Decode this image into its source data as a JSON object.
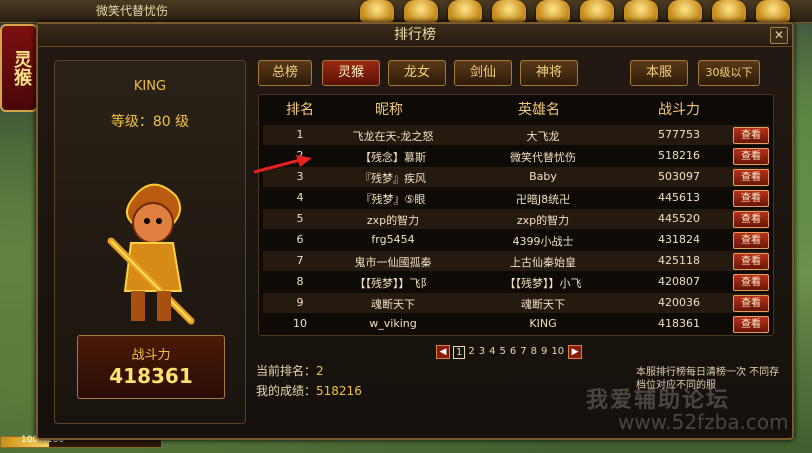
{
  "topbar": {
    "title": "微笑代替忧伤"
  },
  "left_tab": {
    "label": "灵猴"
  },
  "hp": {
    "text": "1007/100",
    "fill_fraction": 0.3
  },
  "window": {
    "title": "排行榜",
    "close": "✕"
  },
  "hero": {
    "name": "KING",
    "level": "等级：80 级",
    "power_label": "战斗力",
    "power_value": "418361"
  },
  "tabs": [
    "总榜",
    "灵猴",
    "龙女",
    "剑仙",
    "神将",
    "本服",
    "30级以下"
  ],
  "active_tab": 1,
  "table": {
    "headers": [
      "排名",
      "昵称",
      "英雄名",
      "战斗力"
    ],
    "view_label": "查看",
    "rows": [
      {
        "rank": "1",
        "nick": "飞龙在天-龙之怒",
        "hero": "大飞龙",
        "power": "577753"
      },
      {
        "rank": "2",
        "nick": "【残念】慕斯",
        "hero": "微笑代替忧伤",
        "power": "518216"
      },
      {
        "rank": "3",
        "nick": "『残梦』疾风",
        "hero": "Baby",
        "power": "503097"
      },
      {
        "rank": "4",
        "nick": "『残梦』⑤眼",
        "hero": "卍暗J8统卍",
        "power": "445613"
      },
      {
        "rank": "5",
        "nick": "zxp的智力",
        "hero": "zxp的智力",
        "power": "445520"
      },
      {
        "rank": "6",
        "nick": "frg5454",
        "hero": "4399小战士",
        "power": "431824"
      },
      {
        "rank": "7",
        "nick": "鬼市一仙國孤秦",
        "hero": "上古仙秦始皇",
        "power": "425118"
      },
      {
        "rank": "8",
        "nick": "【【残梦】】飞阝",
        "hero": "【【残梦】】小飞",
        "power": "420807"
      },
      {
        "rank": "9",
        "nick": "魂断天下",
        "hero": "魂断天下",
        "power": "420036"
      },
      {
        "rank": "10",
        "nick": "w_viking",
        "hero": "KING",
        "power": "418361"
      }
    ]
  },
  "pager": {
    "prev": "◀",
    "next": "▶",
    "pages": [
      "1",
      "2",
      "3",
      "4",
      "5",
      "6",
      "7",
      "8",
      "9",
      "10"
    ],
    "current": 0
  },
  "info": {
    "rank_label": "当前排名：",
    "rank_value": "2",
    "score_label": "我的成绩：",
    "score_value": "518216"
  },
  "notice": "本服排行榜每日清榜一次 不同存档位对应不同的服",
  "watermark": {
    "line1": "我爱辅助论坛",
    "line2": "www.52fzba.com"
  },
  "colors": {
    "accent": "#f2c040",
    "button_red": "#b83018",
    "panel": "#1a140e"
  }
}
